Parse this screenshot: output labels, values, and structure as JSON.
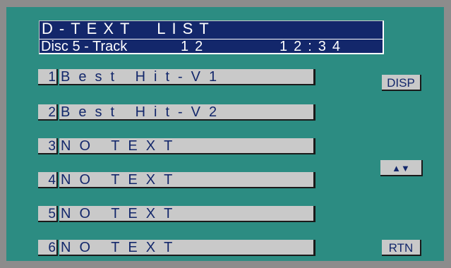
{
  "header": {
    "title": "D-TEXT  LIST",
    "disc_track": "Disc 5 - Track",
    "track_number": "12",
    "time": "12:34"
  },
  "rows": [
    {
      "number": "1",
      "text": "Best Hit-V1"
    },
    {
      "number": "2",
      "text": "Best Hit-V2"
    },
    {
      "number": "3",
      "text": "NO TEXT"
    },
    {
      "number": "4",
      "text": "NO TEXT"
    },
    {
      "number": "5",
      "text": "NO TEXT"
    },
    {
      "number": "6",
      "text": "NO TEXT"
    }
  ],
  "buttons": {
    "disp_label": "DISP",
    "scroll_glyph": "▲▼",
    "rtn_label": "RTN"
  },
  "colors": {
    "screen_background": "#2c8c82",
    "title_background": "#13276b",
    "button_face": "#c9c9c9",
    "text_dark": "#13276b"
  }
}
